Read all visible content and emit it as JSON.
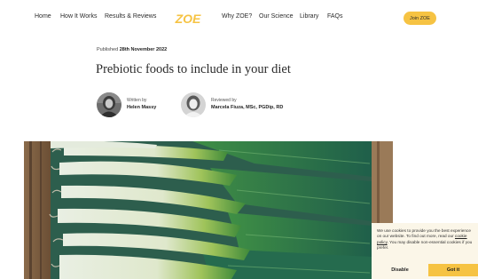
{
  "header": {
    "nav_left": [
      "Home",
      "How It Works",
      "Results & Reviews"
    ],
    "logo_text": "ZOE",
    "nav_right": [
      "Why ZOE?",
      "Our Science",
      "Library",
      "FAQs"
    ],
    "cta_label": "Join ZOE"
  },
  "article": {
    "published_label": "Published",
    "published_date": "28th November 2022",
    "title": "Prebiotic foods to include in your diet",
    "author": {
      "role": "Written by",
      "name": "Helen Massy"
    },
    "reviewer": {
      "role": "Reviewed by",
      "name": "Marcela Fiuza, MSc, PGDip, RD"
    }
  },
  "hero": {
    "icon": "leeks-photo"
  },
  "cookie_banner": {
    "text_before": "We use cookies to provide you the best experience on our website. To find out more, read our ",
    "link_text": "cookie policy",
    "text_after": ". You may disable non-essential cookies if you prefer.",
    "disable_label": "Disable",
    "accept_label": "Got it"
  },
  "colors": {
    "brand_yellow": "#f6c343",
    "banner_bg": "#fbf6e8",
    "text": "#2b2b2b"
  }
}
